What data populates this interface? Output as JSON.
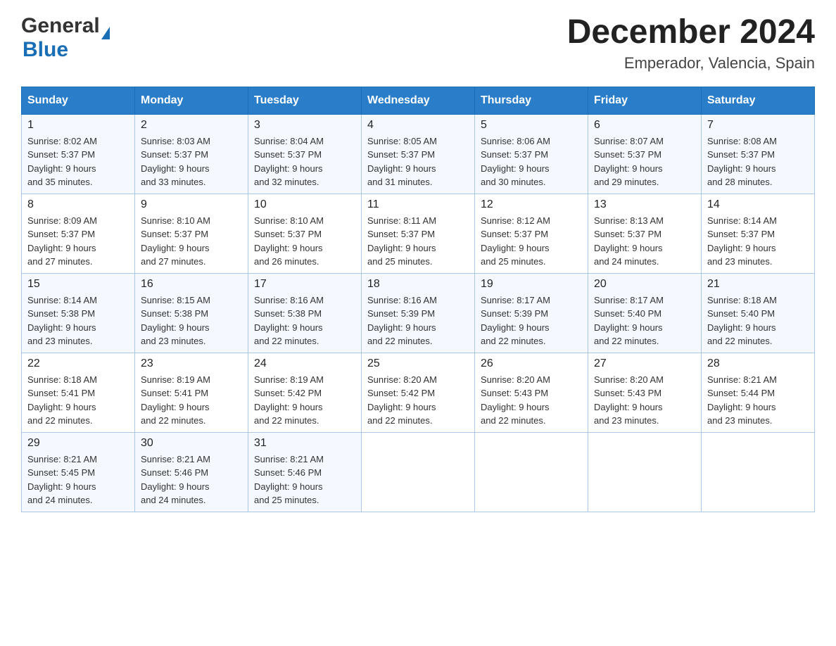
{
  "header": {
    "logo_general": "General",
    "logo_blue": "Blue",
    "month_year": "December 2024",
    "location": "Emperador, Valencia, Spain"
  },
  "weekdays": [
    "Sunday",
    "Monday",
    "Tuesday",
    "Wednesday",
    "Thursday",
    "Friday",
    "Saturday"
  ],
  "weeks": [
    [
      {
        "num": "1",
        "sunrise": "8:02 AM",
        "sunset": "5:37 PM",
        "daylight": "9 hours and 35 minutes."
      },
      {
        "num": "2",
        "sunrise": "8:03 AM",
        "sunset": "5:37 PM",
        "daylight": "9 hours and 33 minutes."
      },
      {
        "num": "3",
        "sunrise": "8:04 AM",
        "sunset": "5:37 PM",
        "daylight": "9 hours and 32 minutes."
      },
      {
        "num": "4",
        "sunrise": "8:05 AM",
        "sunset": "5:37 PM",
        "daylight": "9 hours and 31 minutes."
      },
      {
        "num": "5",
        "sunrise": "8:06 AM",
        "sunset": "5:37 PM",
        "daylight": "9 hours and 30 minutes."
      },
      {
        "num": "6",
        "sunrise": "8:07 AM",
        "sunset": "5:37 PM",
        "daylight": "9 hours and 29 minutes."
      },
      {
        "num": "7",
        "sunrise": "8:08 AM",
        "sunset": "5:37 PM",
        "daylight": "9 hours and 28 minutes."
      }
    ],
    [
      {
        "num": "8",
        "sunrise": "8:09 AM",
        "sunset": "5:37 PM",
        "daylight": "9 hours and 27 minutes."
      },
      {
        "num": "9",
        "sunrise": "8:10 AM",
        "sunset": "5:37 PM",
        "daylight": "9 hours and 27 minutes."
      },
      {
        "num": "10",
        "sunrise": "8:10 AM",
        "sunset": "5:37 PM",
        "daylight": "9 hours and 26 minutes."
      },
      {
        "num": "11",
        "sunrise": "8:11 AM",
        "sunset": "5:37 PM",
        "daylight": "9 hours and 25 minutes."
      },
      {
        "num": "12",
        "sunrise": "8:12 AM",
        "sunset": "5:37 PM",
        "daylight": "9 hours and 25 minutes."
      },
      {
        "num": "13",
        "sunrise": "8:13 AM",
        "sunset": "5:37 PM",
        "daylight": "9 hours and 24 minutes."
      },
      {
        "num": "14",
        "sunrise": "8:14 AM",
        "sunset": "5:37 PM",
        "daylight": "9 hours and 23 minutes."
      }
    ],
    [
      {
        "num": "15",
        "sunrise": "8:14 AM",
        "sunset": "5:38 PM",
        "daylight": "9 hours and 23 minutes."
      },
      {
        "num": "16",
        "sunrise": "8:15 AM",
        "sunset": "5:38 PM",
        "daylight": "9 hours and 23 minutes."
      },
      {
        "num": "17",
        "sunrise": "8:16 AM",
        "sunset": "5:38 PM",
        "daylight": "9 hours and 22 minutes."
      },
      {
        "num": "18",
        "sunrise": "8:16 AM",
        "sunset": "5:39 PM",
        "daylight": "9 hours and 22 minutes."
      },
      {
        "num": "19",
        "sunrise": "8:17 AM",
        "sunset": "5:39 PM",
        "daylight": "9 hours and 22 minutes."
      },
      {
        "num": "20",
        "sunrise": "8:17 AM",
        "sunset": "5:40 PM",
        "daylight": "9 hours and 22 minutes."
      },
      {
        "num": "21",
        "sunrise": "8:18 AM",
        "sunset": "5:40 PM",
        "daylight": "9 hours and 22 minutes."
      }
    ],
    [
      {
        "num": "22",
        "sunrise": "8:18 AM",
        "sunset": "5:41 PM",
        "daylight": "9 hours and 22 minutes."
      },
      {
        "num": "23",
        "sunrise": "8:19 AM",
        "sunset": "5:41 PM",
        "daylight": "9 hours and 22 minutes."
      },
      {
        "num": "24",
        "sunrise": "8:19 AM",
        "sunset": "5:42 PM",
        "daylight": "9 hours and 22 minutes."
      },
      {
        "num": "25",
        "sunrise": "8:20 AM",
        "sunset": "5:42 PM",
        "daylight": "9 hours and 22 minutes."
      },
      {
        "num": "26",
        "sunrise": "8:20 AM",
        "sunset": "5:43 PM",
        "daylight": "9 hours and 22 minutes."
      },
      {
        "num": "27",
        "sunrise": "8:20 AM",
        "sunset": "5:43 PM",
        "daylight": "9 hours and 23 minutes."
      },
      {
        "num": "28",
        "sunrise": "8:21 AM",
        "sunset": "5:44 PM",
        "daylight": "9 hours and 23 minutes."
      }
    ],
    [
      {
        "num": "29",
        "sunrise": "8:21 AM",
        "sunset": "5:45 PM",
        "daylight": "9 hours and 24 minutes."
      },
      {
        "num": "30",
        "sunrise": "8:21 AM",
        "sunset": "5:46 PM",
        "daylight": "9 hours and 24 minutes."
      },
      {
        "num": "31",
        "sunrise": "8:21 AM",
        "sunset": "5:46 PM",
        "daylight": "9 hours and 25 minutes."
      },
      null,
      null,
      null,
      null
    ]
  ],
  "labels": {
    "sunrise": "Sunrise:",
    "sunset": "Sunset:",
    "daylight": "Daylight:"
  }
}
